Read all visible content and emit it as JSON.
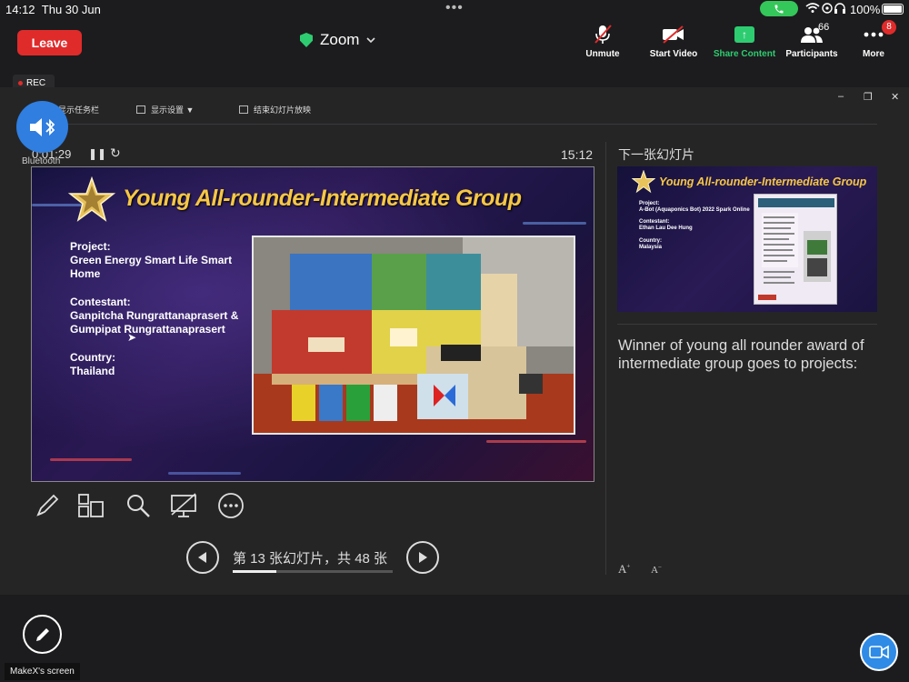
{
  "status_bar": {
    "time": "14:12",
    "date": "Thu 30 Jun",
    "battery": "100%"
  },
  "topbar": {
    "leave_label": "Leave",
    "title": "Zoom",
    "unmute_label": "Unmute",
    "start_video_label": "Start Video",
    "share_label": "Share Content",
    "participants_label": "Participants",
    "participants_count": "66",
    "more_label": "More",
    "more_badge": "8"
  },
  "rec_label": "REC",
  "bluetooth_label": "Bluetooth",
  "presenter_toolbar": {
    "taskbar": "显示任务栏",
    "display_settings": "显示设置 ▼",
    "end_slideshow": "结束幻灯片放映"
  },
  "presenter": {
    "timer": "0:01:29",
    "clock": "15:12",
    "next_slide_label": "下一张幻灯片",
    "slide_counter": "第 13 张幻灯片，共 48 张",
    "progress": 0.27,
    "notes": "Winner of young all rounder award of intermediate group goes to projects:"
  },
  "slide": {
    "title": "Young All-rounder-Intermediate Group",
    "project_label": "Project:",
    "project_line1": "Green Energy Smart Life Smart",
    "project_line2": "Home",
    "contestant_label": "Contestant:",
    "contestant_line1": "Ganpitcha Rungrattanaprasert &",
    "contestant_line2": "Gumpipat Rungrattanaprasert",
    "country_label": "Country:",
    "country": "Thailand"
  },
  "next_slide": {
    "title": "Young All-rounder-Intermediate Group",
    "project_label": "Project:",
    "project": "A-Bot (Aquaponics Bot) 2022 Spark Online",
    "contestant_label": "Contestant:",
    "contestant": "Ethan Lau Dee Hung",
    "country_label": "Country:",
    "country": "Malaysia"
  },
  "screen_label": "MakeX's screen",
  "colors": {
    "leave": "#e02b2b",
    "share": "#2ecc71",
    "accent_blue": "#2f7ee0",
    "slide_title": "#f6c744"
  }
}
